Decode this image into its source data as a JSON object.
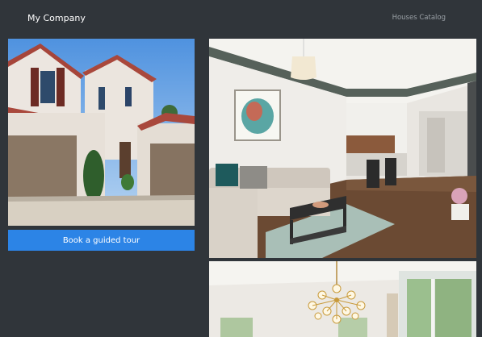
{
  "header": {
    "brand": "My Company",
    "nav_link": "Houses Catalog"
  },
  "gallery": {
    "house_image": "house-exterior",
    "living_image": "living-room",
    "dining_image": "dining-room"
  },
  "cta": {
    "label": "Book a guided tour"
  },
  "colors": {
    "background": "#30353a",
    "accent": "#2c84e6"
  }
}
